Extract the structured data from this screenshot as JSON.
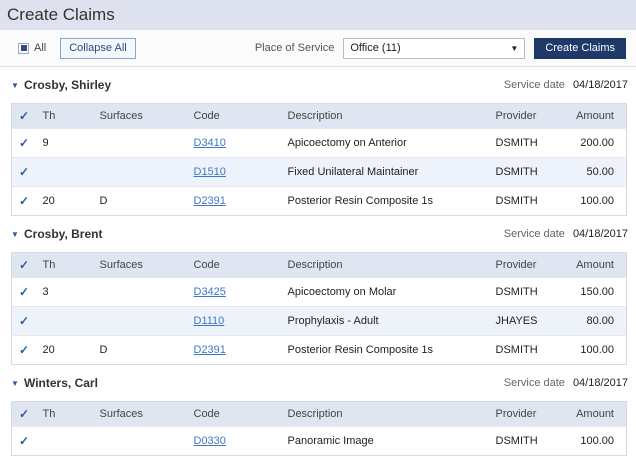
{
  "title": "Create Claims",
  "toolbar": {
    "all_label": "All",
    "collapse_label": "Collapse All",
    "place_label": "Place of Service",
    "place_value": "Office (11)",
    "create_label": "Create Claims"
  },
  "columns": {
    "th": "Th",
    "surfaces": "Surfaces",
    "code": "Code",
    "description": "Description",
    "provider": "Provider",
    "amount": "Amount"
  },
  "service_date_label": "Service date",
  "patients": [
    {
      "name": "Crosby, Shirley",
      "service_date": "04/18/2017",
      "rows": [
        {
          "th": "9",
          "surfaces": "",
          "code": "D3410",
          "description": "Apicoectomy on Anterior",
          "provider": "DSMITH",
          "amount": "200.00"
        },
        {
          "th": "",
          "surfaces": "",
          "code": "D1510",
          "description": "Fixed Unilateral Maintainer",
          "provider": "DSMITH",
          "amount": "50.00"
        },
        {
          "th": "20",
          "surfaces": "D",
          "code": "D2391",
          "description": "Posterior Resin Composite 1s",
          "provider": "DSMITH",
          "amount": "100.00"
        }
      ]
    },
    {
      "name": "Crosby, Brent",
      "service_date": "04/18/2017",
      "rows": [
        {
          "th": "3",
          "surfaces": "",
          "code": "D3425",
          "description": "Apicoectomy on Molar",
          "provider": "DSMITH",
          "amount": "150.00"
        },
        {
          "th": "",
          "surfaces": "",
          "code": "D1110",
          "description": "Prophylaxis - Adult",
          "provider": "JHAYES",
          "amount": "80.00"
        },
        {
          "th": "20",
          "surfaces": "D",
          "code": "D2391",
          "description": "Posterior Resin Composite 1s",
          "provider": "DSMITH",
          "amount": "100.00"
        }
      ]
    },
    {
      "name": "Winters, Carl",
      "service_date": "04/18/2017",
      "rows": [
        {
          "th": "",
          "surfaces": "",
          "code": "D0330",
          "description": "Panoramic Image",
          "provider": "DSMITH",
          "amount": "100.00"
        }
      ]
    }
  ]
}
